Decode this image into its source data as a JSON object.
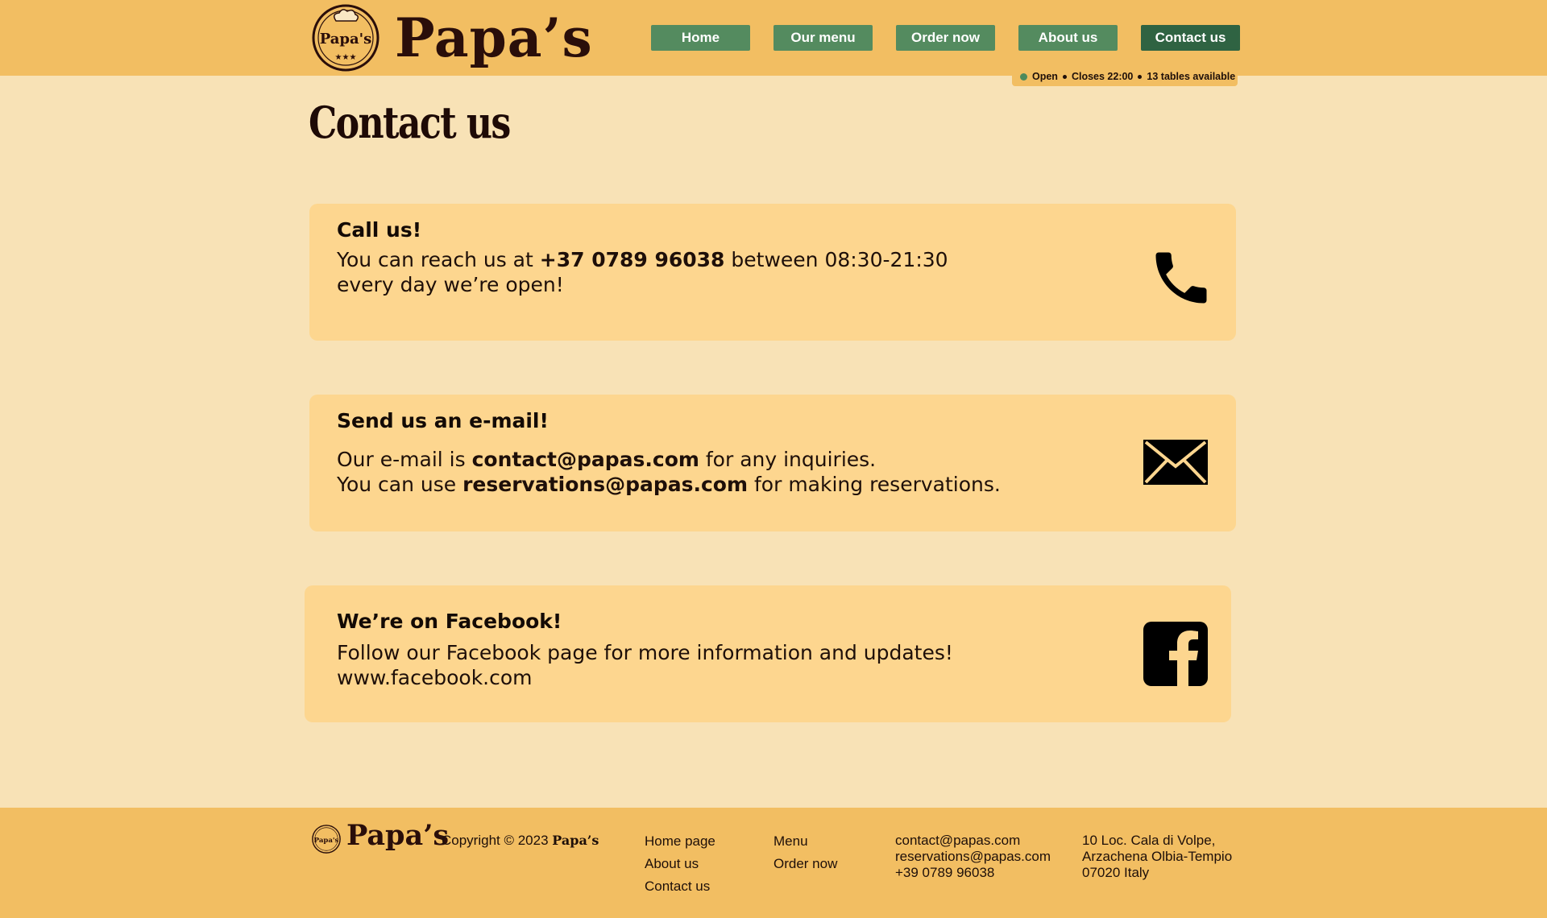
{
  "header": {
    "logo_text": "Papa's",
    "brand": "Papa’s",
    "nav": [
      {
        "label": "Home",
        "active": false
      },
      {
        "label": "Our menu",
        "active": false
      },
      {
        "label": "Order now",
        "active": false
      },
      {
        "label": "About us",
        "active": false
      },
      {
        "label": "Contact us",
        "active": true
      }
    ],
    "status": {
      "open_label": "Open",
      "closes_label": "Closes 22:00",
      "tables_count": "13",
      "tables_label": "tables available"
    }
  },
  "page": {
    "title": "Contact us"
  },
  "cards": {
    "call": {
      "title": "Call us!",
      "line1_pre": "You can reach us at ",
      "phone": "+37 0789 96038",
      "line1_post": " between 08:30-21:30",
      "line2": "every day we’re open!",
      "icon": "phone-icon"
    },
    "email": {
      "title": "Send us an e-mail!",
      "line1_pre": "Our e-mail is ",
      "contact_email": "contact@papas.com",
      "line1_post": " for any inquiries.",
      "line2_pre": "You can use ",
      "reservation_email": "reservations@papas.com",
      "line2_post": " for making reservations.",
      "icon": "envelope-icon"
    },
    "facebook": {
      "title": "We’re on Facebook!",
      "line1": "Follow our Facebook page for more information and updates!",
      "link": "www.facebook.com",
      "icon": "facebook-icon"
    }
  },
  "footer": {
    "brand": "Papa’s",
    "copyright_prefix": "Copyright © 2023 ",
    "copyright_brand": "Papa’s",
    "col1": [
      "Home page",
      "About us",
      "Contact us"
    ],
    "col2": [
      "Menu",
      "Order now"
    ],
    "contacts": [
      "contact@papas.com",
      "reservations@papas.com",
      "+39 0789 96038"
    ],
    "address": [
      "10 Loc. Cala di Volpe,",
      "Arzachena Olbia-Tempio",
      "07020 Italy"
    ]
  },
  "colors": {
    "header_bg": "#f2be62",
    "page_bg": "#f8e2b6",
    "card_bg": "#fdd68f",
    "nav_green": "#548b5f",
    "nav_active": "#2f6342",
    "status_green": "#4e8a5c"
  }
}
